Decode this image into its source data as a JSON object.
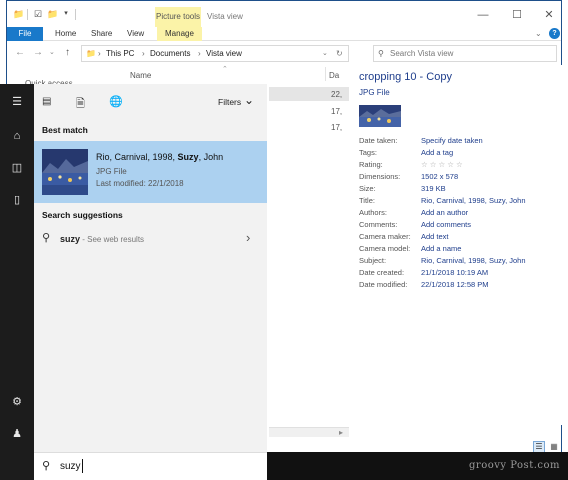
{
  "explorer": {
    "context_tab": "Picture tools",
    "window_title": "Vista view",
    "ribbon_tabs": [
      "File",
      "Home",
      "Share",
      "View",
      "Manage"
    ],
    "address": [
      "This PC",
      "Documents",
      "Vista view"
    ],
    "search_placeholder": "Search Vista view",
    "column_name": "Name",
    "column_date": "Da",
    "quick_access": "Quick access",
    "rows": [
      "22,",
      "17,",
      "17,"
    ]
  },
  "preview": {
    "title": "cropping 10 - Copy",
    "type": "JPG File",
    "properties": [
      {
        "label": "Date taken:",
        "value": "Specify date taken"
      },
      {
        "label": "Tags:",
        "value": "Add a tag"
      },
      {
        "label": "Rating:",
        "value": ""
      },
      {
        "label": "Dimensions:",
        "value": "1502 x 578"
      },
      {
        "label": "Size:",
        "value": "319 KB"
      },
      {
        "label": "Title:",
        "value": "Rio, Carnival, 1998, Suzy, John"
      },
      {
        "label": "Authors:",
        "value": "Add an author"
      },
      {
        "label": "Comments:",
        "value": "Add comments"
      },
      {
        "label": "Camera maker:",
        "value": "Add text"
      },
      {
        "label": "Camera model:",
        "value": "Add a name"
      },
      {
        "label": "Subject:",
        "value": "Rio, Carnival, 1998, Suzy, John"
      },
      {
        "label": "Date created:",
        "value": "21/1/2018 10:19 AM"
      },
      {
        "label": "Date modified:",
        "value": "22/1/2018 12:58 PM"
      }
    ],
    "rating_stars": 0
  },
  "search_panel": {
    "filters_label": "Filters",
    "best_match_heading": "Best match",
    "best_match": {
      "title_before": "Rio, Carnival, 1998, ",
      "title_bold": "Suzy",
      "title_after": ", John",
      "type": "JPG File",
      "modified": "Last modified: 22/1/2018"
    },
    "suggestions_heading": "Search suggestions",
    "suggestion_query": "suzy",
    "suggestion_hint": " - See web results",
    "query": "suzy"
  },
  "watermark": "groovy Post.com",
  "colors": {
    "accent": "#1979ca",
    "selection": "#acd1f0",
    "rail": "#1c1c1c",
    "link": "#1f3e8c"
  }
}
